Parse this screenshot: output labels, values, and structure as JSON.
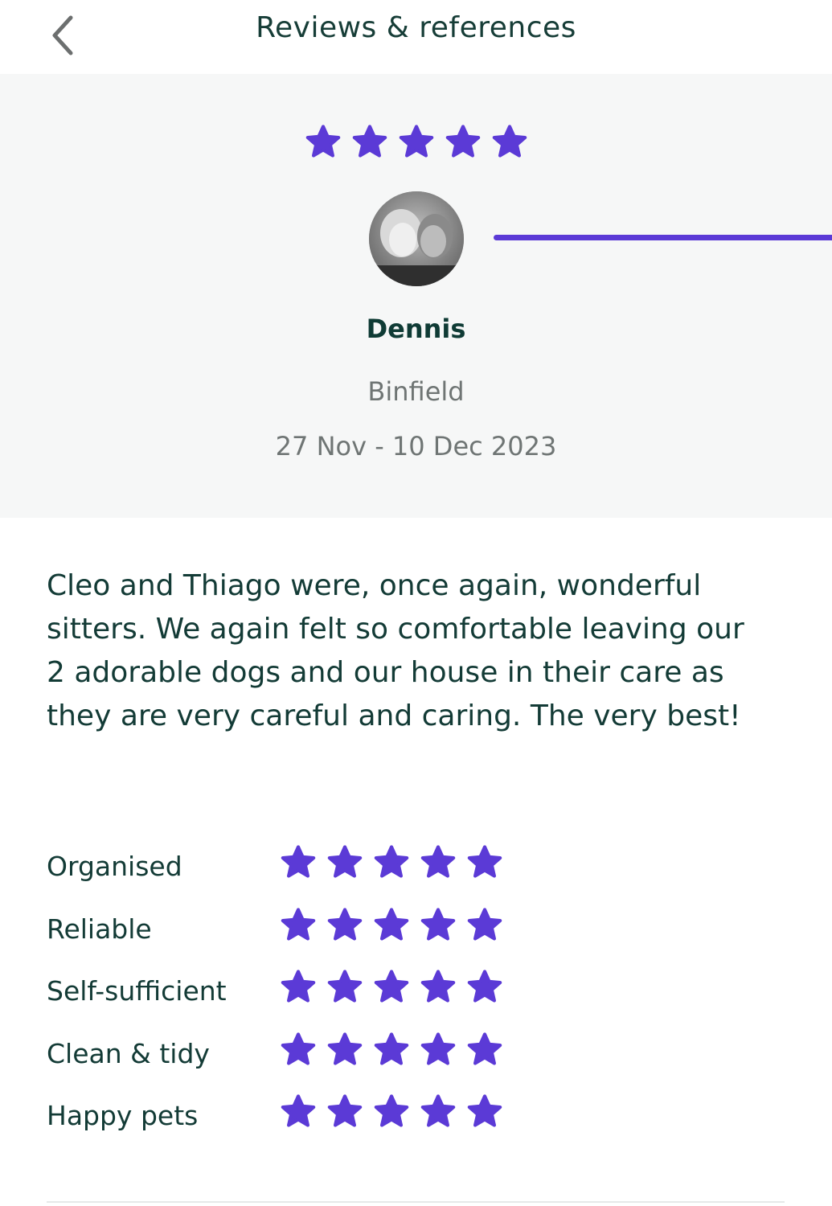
{
  "header": {
    "back_icon": "chevron-left-icon",
    "title": "Reviews & references"
  },
  "review": {
    "overall_rating": 5,
    "overall_rating_max": 5,
    "reviewer_name": "Dennis",
    "location": "Binfield",
    "dates": "27 Nov - 10 Dec 2023",
    "text": "Cleo and Thiago were, once again, wonderful sitters. We again felt  so comfortable leaving our 2 adorable dogs and our house in their care as they are very careful and caring. The very best!"
  },
  "ratings": [
    {
      "label": "Organised",
      "stars": 5
    },
    {
      "label": "Reliable",
      "stars": 5
    },
    {
      "label": "Self-sufficient",
      "stars": 5
    },
    {
      "label": "Clean & tidy",
      "stars": 5
    },
    {
      "label": "Happy pets",
      "stars": 5
    }
  ],
  "colors": {
    "star": "#5b3ad6",
    "text": "#133b36",
    "muted": "#6f7574",
    "card_bg": "#f6f7f7"
  }
}
